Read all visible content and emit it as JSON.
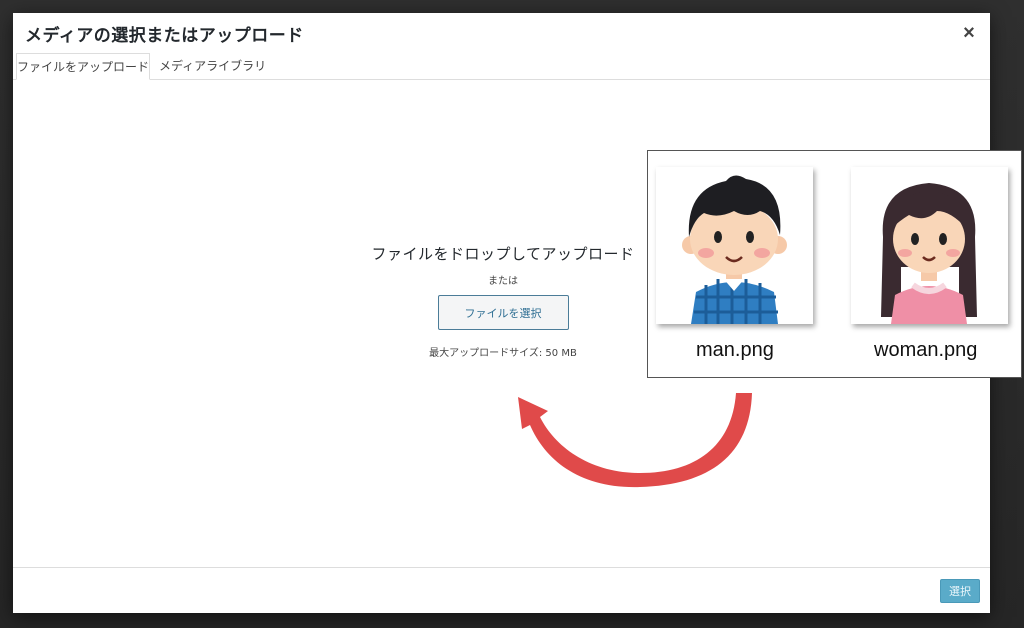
{
  "dialog": {
    "title": "メディアの選択またはアップロード",
    "close_label": "×",
    "tabs": [
      {
        "label": "ファイルをアップロード",
        "active": true
      },
      {
        "label": "メディアライブラリ",
        "active": false
      }
    ]
  },
  "uploader": {
    "drop_text": "ファイルをドロップしてアップロード",
    "or_text": "または",
    "select_button": "ファイルを選択",
    "max_size": "最大アップロードサイズ: 50 MB"
  },
  "footer": {
    "select_button": "選択"
  },
  "overlay": {
    "files": [
      {
        "name": "man.png",
        "icon": "man-avatar"
      },
      {
        "name": "woman.png",
        "icon": "woman-avatar"
      }
    ]
  },
  "colors": {
    "accent": "#2e6e93",
    "primary_button": "#5aabc9",
    "arrow": "#e04a4a"
  }
}
